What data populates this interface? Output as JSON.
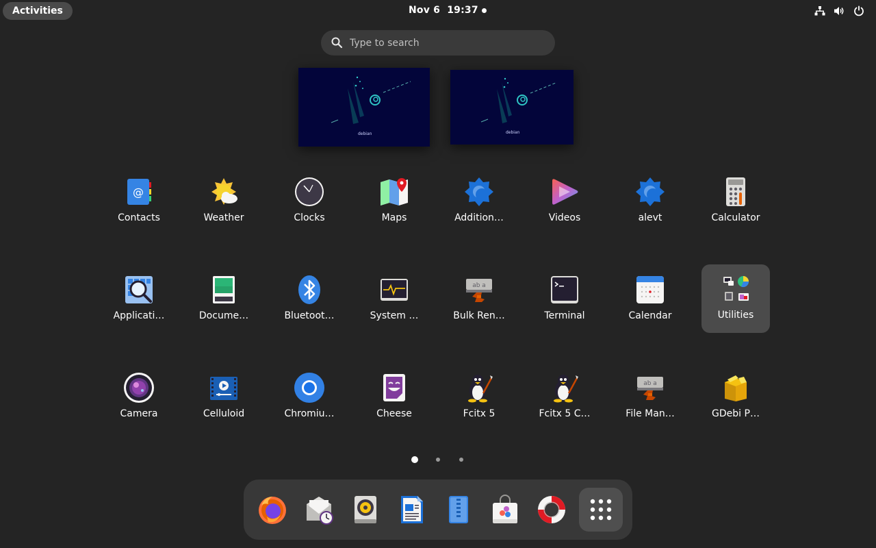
{
  "topbar": {
    "activities_label": "Activities",
    "datetime": "Nov 6  19:37",
    "tray_icons": [
      "network-icon",
      "volume-icon",
      "power-icon"
    ]
  },
  "search": {
    "placeholder": "Type to search",
    "value": ""
  },
  "workspaces": [
    {
      "logo_text": "debian"
    },
    {
      "logo_text": "debian"
    }
  ],
  "apps": [
    {
      "label": "Contacts",
      "icon": "contacts-icon"
    },
    {
      "label": "Weather",
      "icon": "weather-icon"
    },
    {
      "label": "Clocks",
      "icon": "clocks-icon"
    },
    {
      "label": "Maps",
      "icon": "maps-icon"
    },
    {
      "label": "Addition…",
      "icon": "additional-drivers-icon"
    },
    {
      "label": "Videos",
      "icon": "videos-icon"
    },
    {
      "label": "alevt",
      "icon": "alevt-icon"
    },
    {
      "label": "Calculator",
      "icon": "calculator-icon"
    },
    {
      "label": "Applicati…",
      "icon": "application-finder-icon"
    },
    {
      "label": "Docume…",
      "icon": "document-scanner-icon"
    },
    {
      "label": "Bluetoot…",
      "icon": "bluetooth-icon"
    },
    {
      "label": "System …",
      "icon": "system-monitor-icon"
    },
    {
      "label": "Bulk Ren…",
      "icon": "bulk-rename-icon"
    },
    {
      "label": "Terminal",
      "icon": "terminal-icon"
    },
    {
      "label": "Calendar",
      "icon": "calendar-icon"
    },
    {
      "label": "Utilities",
      "icon": "utilities-folder-icon"
    },
    {
      "label": "Camera",
      "icon": "camera-icon"
    },
    {
      "label": "Celluloid",
      "icon": "celluloid-icon"
    },
    {
      "label": "Chromiu…",
      "icon": "chromium-icon"
    },
    {
      "label": "Cheese",
      "icon": "cheese-icon"
    },
    {
      "label": "Fcitx 5",
      "icon": "fcitx5-icon"
    },
    {
      "label": "Fcitx 5 C…",
      "icon": "fcitx5-config-icon"
    },
    {
      "label": "File Man…",
      "icon": "file-manager-icon"
    },
    {
      "label": "GDebi P…",
      "icon": "gdebi-icon"
    }
  ],
  "pagination": {
    "pages": 3,
    "current": 1
  },
  "dock": [
    {
      "name": "firefox",
      "icon": "firefox-icon"
    },
    {
      "name": "evolution",
      "icon": "mail-clock-icon"
    },
    {
      "name": "rhythmbox",
      "icon": "speaker-icon"
    },
    {
      "name": "libreoffice-writer",
      "icon": "writer-icon"
    },
    {
      "name": "file-archiver",
      "icon": "archive-icon"
    },
    {
      "name": "software",
      "icon": "software-bag-icon"
    },
    {
      "name": "help",
      "icon": "lifebuoy-icon"
    },
    {
      "name": "show-apps",
      "icon": "app-grid-icon"
    }
  ],
  "colors": {
    "background": "#242424",
    "search_bg": "#3a3a3a",
    "dock_bg": "#383838",
    "selected_tile": "#4b4b4b"
  }
}
